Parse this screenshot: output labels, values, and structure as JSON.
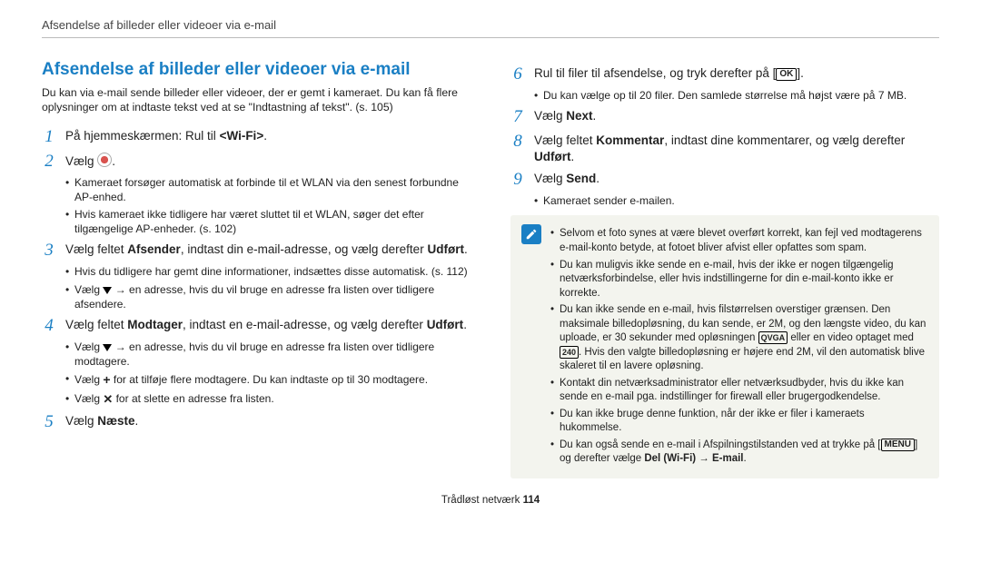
{
  "header": {
    "running_title": "Afsendelse af billeder eller videoer via e-mail"
  },
  "left": {
    "title": "Afsendelse af billeder eller videoer via e-mail",
    "intro": "Du kan via e-mail sende billeder eller videoer, der er gemt i kameraet. Du kan få flere oplysninger om at indtaste tekst ved at se \"Indtastning af tekst\". (s. 105)",
    "steps": {
      "s1": {
        "num": "1",
        "pre": "På hjemmeskærmen: Rul til ",
        "tag": "<Wi-Fi>",
        "post": "."
      },
      "s2": {
        "num": "2",
        "text": "Vælg ",
        "icon_name": "power-icon",
        "after": "."
      },
      "s2_sub": [
        "Kameraet forsøger automatisk at forbinde til et WLAN via den senest forbundne AP-enhed.",
        "Hvis kameraet ikke tidligere har været sluttet til et WLAN, søger det efter tilgængelige AP-enheder. (s. 102)"
      ],
      "s3": {
        "num": "3",
        "a": "Vælg feltet ",
        "b1": "Afsender",
        "b": ", indtast din e-mail-adresse, og vælg derefter ",
        "b2": "Udført",
        "c": "."
      },
      "s3_sub": [
        "Hvis du tidligere har gemt dine informationer, indsættes disse automatisk. (s. 112)",
        " → en adresse, hvis du vil bruge en adresse fra listen over tidligere afsendere."
      ],
      "s3_sub_prefix": "Vælg ",
      "s4": {
        "num": "4",
        "a": "Vælg feltet ",
        "b1": "Modtager",
        "b": ", indtast en e-mail-adresse, og vælg derefter ",
        "b2": "Udført",
        "c": "."
      },
      "s4_sub": [
        " → en adresse, hvis du vil bruge en adresse fra listen over tidligere modtagere.",
        " for at tilføje flere modtagere. Du kan indtaste op til 30 modtagere.",
        " for at slette en adresse fra listen."
      ],
      "s4_sub_prefix": "Vælg ",
      "s5": {
        "num": "5",
        "a": "Vælg ",
        "b": "Næste",
        "c": "."
      }
    }
  },
  "right": {
    "s6": {
      "num": "6",
      "a": "Rul til filer til afsendelse, og tryk derefter på [",
      "ok": "OK",
      "b": "]."
    },
    "s6_sub": [
      "Du kan vælge op til 20 filer. Den samlede størrelse må højst være på 7 MB."
    ],
    "s7": {
      "num": "7",
      "a": "Vælg ",
      "b": "Next",
      "c": "."
    },
    "s8": {
      "num": "8",
      "a": "Vælg feltet ",
      "b1": "Kommentar",
      "b": ", indtast dine kommentarer, og vælg derefter ",
      "b2": "Udført",
      "c": "."
    },
    "s9": {
      "num": "9",
      "a": "Vælg ",
      "b": "Send",
      "c": "."
    },
    "s9_sub": [
      "Kameraet sender e-mailen."
    ],
    "note": {
      "n1": "Selvom et foto synes at være blevet overført korrekt, kan fejl ved modtagerens e-mail-konto betyde, at fotoet bliver afvist eller opfattes som spam.",
      "n2": "Du kan muligvis ikke sende en e-mail, hvis der ikke er nogen tilgængelig netværksforbindelse, eller hvis indstillingerne for din e-mail-konto ikke er korrekte.",
      "n3a": "Du kan ikke sende en e-mail, hvis filstørrelsen overstiger grænsen. Den maksimale billedopløsning, du kan sende, er 2M, og den længste video, du kan uploade, er 30 sekunder med opløsningen ",
      "n3_vga": "QVGA",
      "n3b": " eller en video optaget med ",
      "n3_rec": "240",
      "n3c": ". Hvis den valgte billedopløsning er højere end 2M, vil den automatisk blive skaleret til en lavere opløsning.",
      "n4": "Kontakt din netværksadministrator eller netværksudbyder, hvis du ikke kan sende en e-mail pga. indstillinger for firewall eller brugergodkendelse.",
      "n5": "Du kan ikke bruge denne funktion, når der ikke er filer i kameraets hukommelse.",
      "n6a": "Du kan også sende en e-mail i Afspilningstilstanden ved at trykke på [",
      "n6_menu": "MENU",
      "n6b": "] og derefter vælge ",
      "n6_bold": "Del (Wi-Fi) → E-mail",
      "n6c": "."
    }
  },
  "footer": {
    "section": "Trådløst netværk  ",
    "page": "114"
  }
}
